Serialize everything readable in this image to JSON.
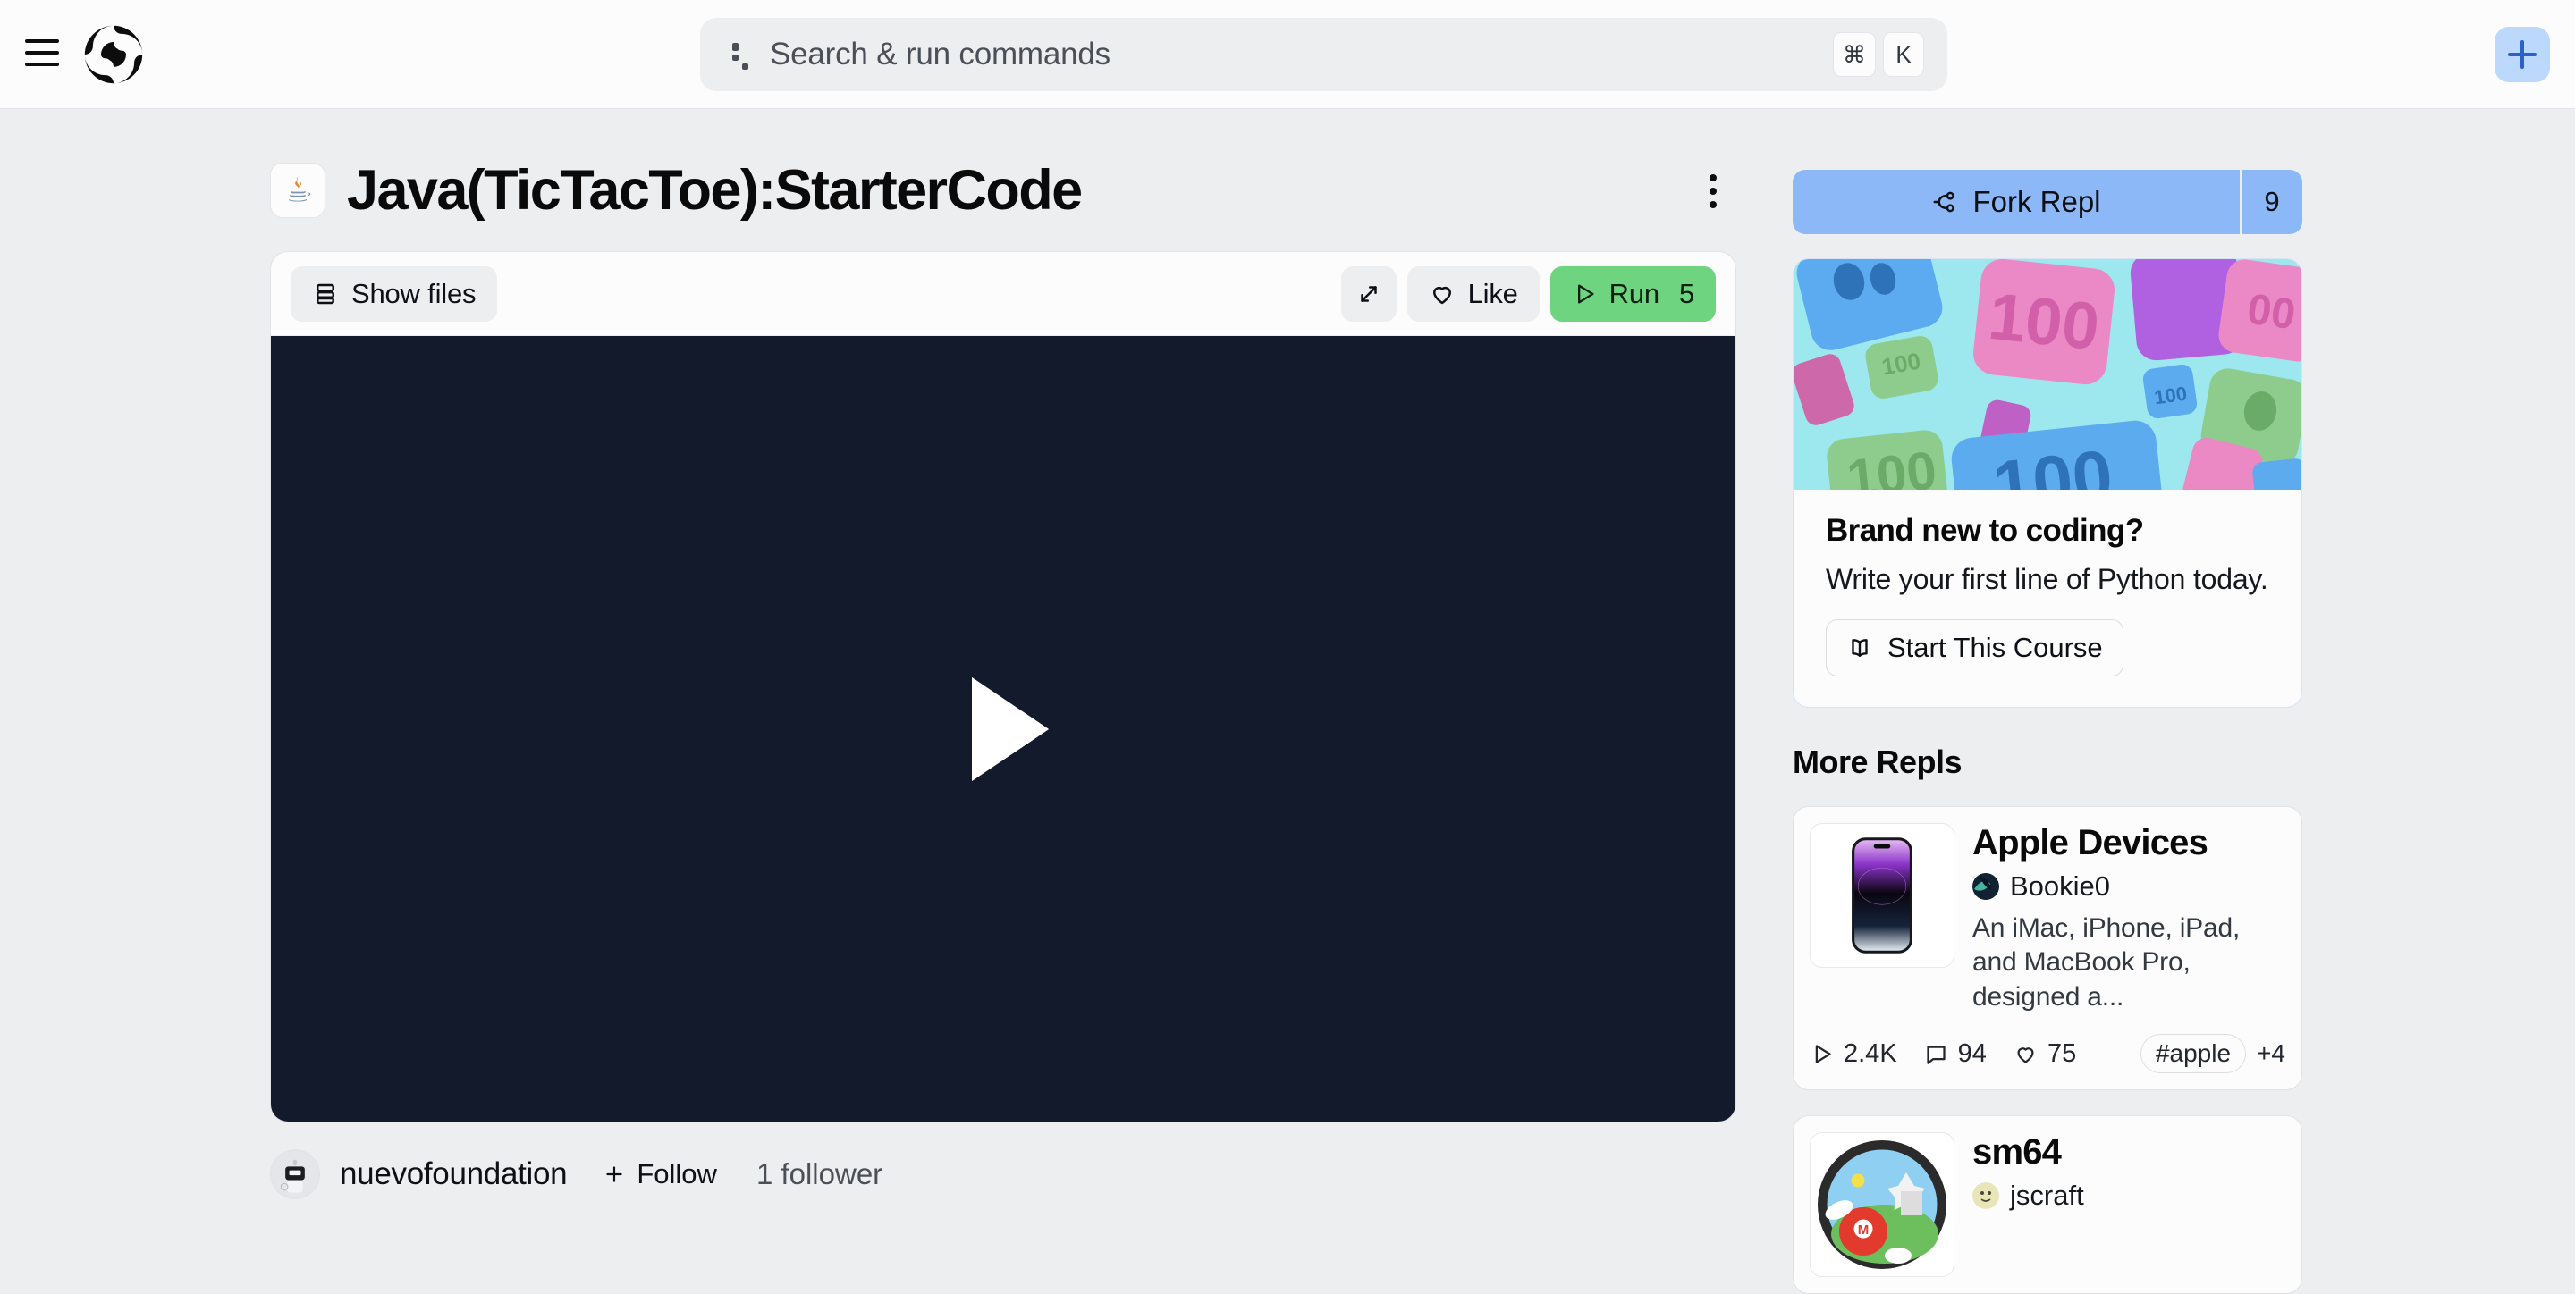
{
  "topbar": {
    "menu_icon": "hamburger-icon",
    "logo_icon": "replit-logo-icon",
    "search": {
      "icon": "command-dots-icon",
      "placeholder": "Search & run commands",
      "kbd_mod": "⌘",
      "kbd_key": "K"
    },
    "new_button_icon": "plus-icon"
  },
  "repl": {
    "lang_icon": "java-icon",
    "title": "Java(TicTacToe):StarterCode",
    "menu_icon": "kebab-menu-icon",
    "toolbar": {
      "show_files_label": "Show files",
      "show_files_icon": "panel-rows-icon",
      "expand_icon": "expand-diagonal-icon",
      "like_label": "Like",
      "like_icon": "heart-icon",
      "run_label": "Run",
      "run_count": "5",
      "run_icon": "play-triangle-icon"
    },
    "player": {
      "play_icon": "play-button-icon",
      "background_color": "#131a2b"
    },
    "author": {
      "avatar_icon": "robot-avatar-icon",
      "username": "nuevofoundation",
      "follow_label": "Follow",
      "follow_icon": "plus-icon",
      "followers": "1 follower"
    }
  },
  "sidebar": {
    "fork": {
      "label": "Fork Repl",
      "icon": "fork-branch-icon",
      "count": "9",
      "color": "#8cb8f7"
    },
    "promo": {
      "image_alt": "hundred-emoji-keycaps-image",
      "title": "Brand new to coding?",
      "subtitle": "Write your first line of Python today.",
      "cta_label": "Start This Course",
      "cta_icon": "book-open-icon"
    },
    "more_repls_heading": "More Repls",
    "repls": [
      {
        "thumb_icon": "iphone-thumbnail-icon",
        "title": "Apple Devices",
        "avatar_icon": "user-avatar-icon",
        "username": "Bookie0",
        "description": "An iMac, iPhone, iPad, and MacBook Pro, designed a...",
        "runs": "2.4K",
        "comments": "94",
        "likes": "75",
        "tag": "#apple",
        "tag_more": "+4"
      },
      {
        "thumb_icon": "mario-thumbnail-icon",
        "title": "sm64",
        "avatar_icon": "user-avatar-icon",
        "username": "jscraft",
        "description": "",
        "runs": "",
        "comments": "",
        "likes": "",
        "tag": "",
        "tag_more": ""
      }
    ]
  }
}
